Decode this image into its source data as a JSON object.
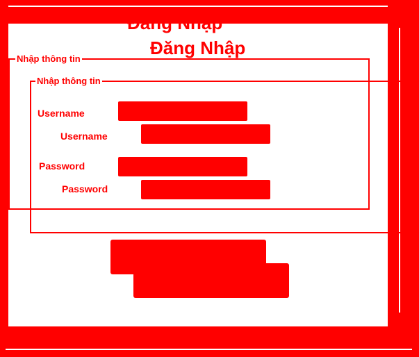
{
  "form": {
    "title": "Đăng Nhập",
    "group_legend": "Nhập thông tin",
    "username_label": "Username",
    "password_label": "Password",
    "username_value": "",
    "password_value": "",
    "login_button": ""
  },
  "colors": {
    "accent": "#ff0000",
    "background": "#ffffff"
  }
}
